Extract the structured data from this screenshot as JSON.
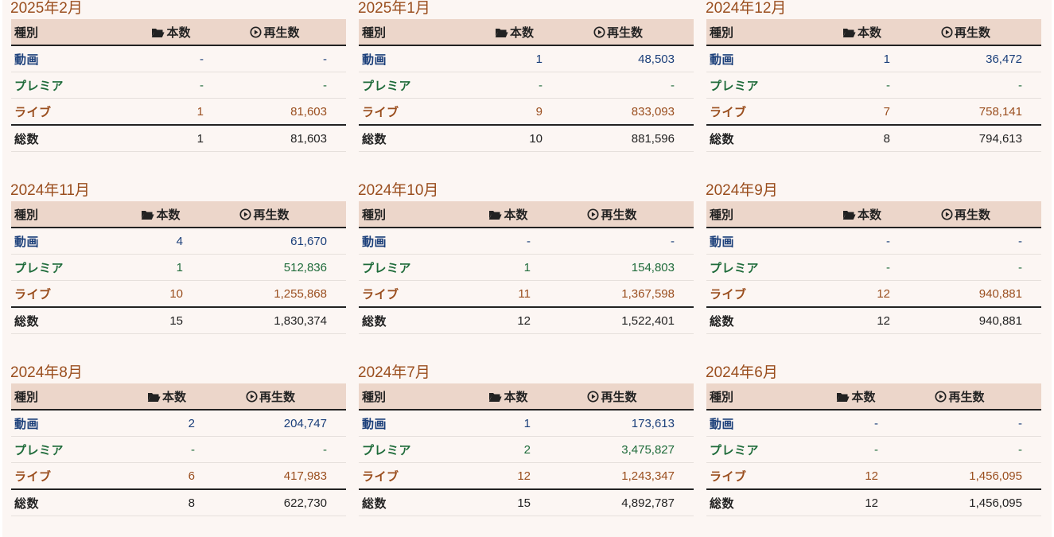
{
  "headers": {
    "type": "種別",
    "count": "本数",
    "views": "再生数"
  },
  "icons": {
    "count": "folder-open-icon",
    "views": "play-circle-icon"
  },
  "colors": {
    "background": "#fcf6f3",
    "header_background": "#ecd6ca",
    "month_title": "#9a4e1e",
    "video": "#1b3f7a",
    "premiere": "#1e6b3a",
    "live": "#9a4e1e",
    "total": "#222222"
  },
  "months": [
    {
      "title": "2025年2月",
      "rows": [
        {
          "kind": "video",
          "type": "動画",
          "count": "-",
          "views": "-"
        },
        {
          "kind": "premiere",
          "type": "プレミア",
          "count": "-",
          "views": "-"
        },
        {
          "kind": "live",
          "type": "ライブ",
          "count": "1",
          "views": "81,603"
        },
        {
          "kind": "total",
          "type": "総数",
          "count": "1",
          "views": "81,603"
        }
      ]
    },
    {
      "title": "2025年1月",
      "rows": [
        {
          "kind": "video",
          "type": "動画",
          "count": "1",
          "views": "48,503"
        },
        {
          "kind": "premiere",
          "type": "プレミア",
          "count": "-",
          "views": "-"
        },
        {
          "kind": "live",
          "type": "ライブ",
          "count": "9",
          "views": "833,093"
        },
        {
          "kind": "total",
          "type": "総数",
          "count": "10",
          "views": "881,596"
        }
      ]
    },
    {
      "title": "2024年12月",
      "rows": [
        {
          "kind": "video",
          "type": "動画",
          "count": "1",
          "views": "36,472"
        },
        {
          "kind": "premiere",
          "type": "プレミア",
          "count": "-",
          "views": "-"
        },
        {
          "kind": "live",
          "type": "ライブ",
          "count": "7",
          "views": "758,141"
        },
        {
          "kind": "total",
          "type": "総数",
          "count": "8",
          "views": "794,613"
        }
      ]
    },
    {
      "title": "2024年11月",
      "rows": [
        {
          "kind": "video",
          "type": "動画",
          "count": "4",
          "views": "61,670"
        },
        {
          "kind": "premiere",
          "type": "プレミア",
          "count": "1",
          "views": "512,836"
        },
        {
          "kind": "live",
          "type": "ライブ",
          "count": "10",
          "views": "1,255,868"
        },
        {
          "kind": "total",
          "type": "総数",
          "count": "15",
          "views": "1,830,374"
        }
      ]
    },
    {
      "title": "2024年10月",
      "rows": [
        {
          "kind": "video",
          "type": "動画",
          "count": "-",
          "views": "-"
        },
        {
          "kind": "premiere",
          "type": "プレミア",
          "count": "1",
          "views": "154,803"
        },
        {
          "kind": "live",
          "type": "ライブ",
          "count": "11",
          "views": "1,367,598"
        },
        {
          "kind": "total",
          "type": "総数",
          "count": "12",
          "views": "1,522,401"
        }
      ]
    },
    {
      "title": "2024年9月",
      "rows": [
        {
          "kind": "video",
          "type": "動画",
          "count": "-",
          "views": "-"
        },
        {
          "kind": "premiere",
          "type": "プレミア",
          "count": "-",
          "views": "-"
        },
        {
          "kind": "live",
          "type": "ライブ",
          "count": "12",
          "views": "940,881"
        },
        {
          "kind": "total",
          "type": "総数",
          "count": "12",
          "views": "940,881"
        }
      ]
    },
    {
      "title": "2024年8月",
      "rows": [
        {
          "kind": "video",
          "type": "動画",
          "count": "2",
          "views": "204,747"
        },
        {
          "kind": "premiere",
          "type": "プレミア",
          "count": "-",
          "views": "-"
        },
        {
          "kind": "live",
          "type": "ライブ",
          "count": "6",
          "views": "417,983"
        },
        {
          "kind": "total",
          "type": "総数",
          "count": "8",
          "views": "622,730"
        }
      ]
    },
    {
      "title": "2024年7月",
      "rows": [
        {
          "kind": "video",
          "type": "動画",
          "count": "1",
          "views": "173,613"
        },
        {
          "kind": "premiere",
          "type": "プレミア",
          "count": "2",
          "views": "3,475,827"
        },
        {
          "kind": "live",
          "type": "ライブ",
          "count": "12",
          "views": "1,243,347"
        },
        {
          "kind": "total",
          "type": "総数",
          "count": "15",
          "views": "4,892,787"
        }
      ]
    },
    {
      "title": "2024年6月",
      "rows": [
        {
          "kind": "video",
          "type": "動画",
          "count": "-",
          "views": "-"
        },
        {
          "kind": "premiere",
          "type": "プレミア",
          "count": "-",
          "views": "-"
        },
        {
          "kind": "live",
          "type": "ライブ",
          "count": "12",
          "views": "1,456,095"
        },
        {
          "kind": "total",
          "type": "総数",
          "count": "12",
          "views": "1,456,095"
        }
      ]
    }
  ]
}
